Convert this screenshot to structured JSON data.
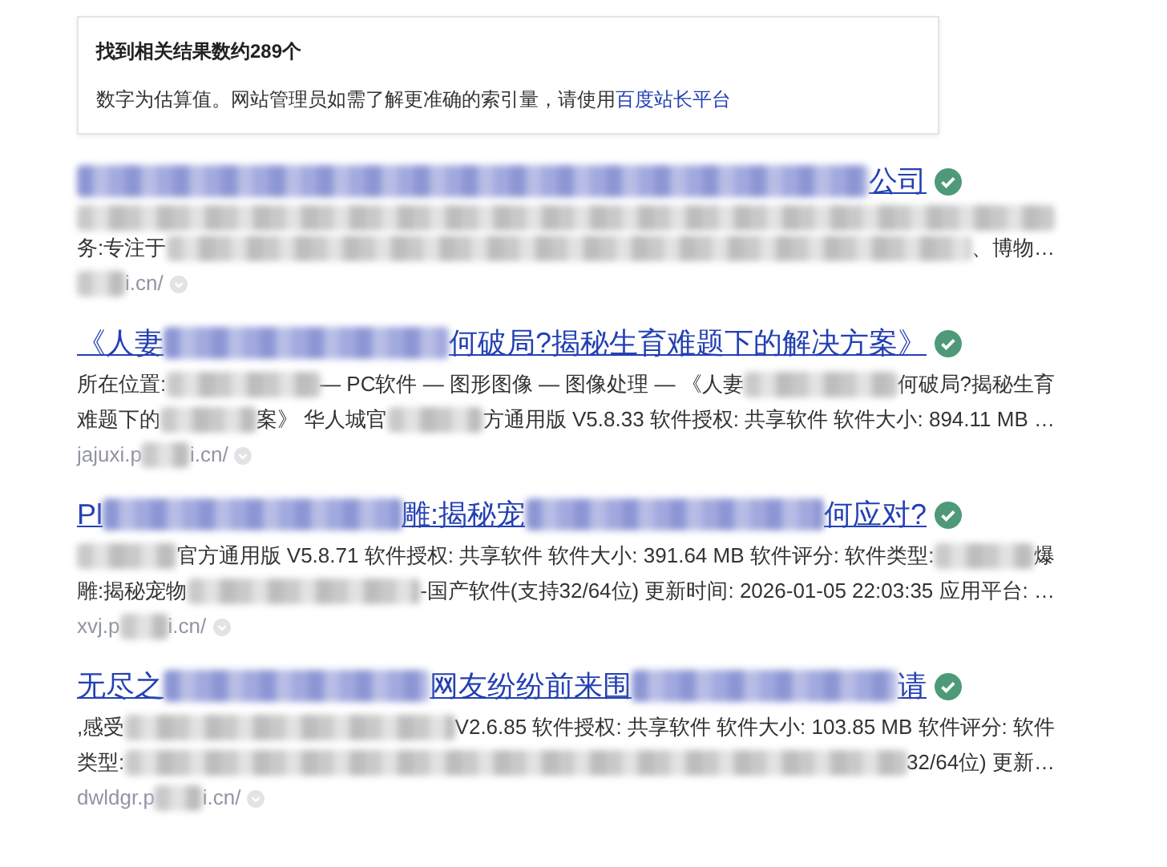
{
  "notice": {
    "heading": "找到相关结果数约289个",
    "text": "数字为估算值。网站管理员如需了解更准确的索引量，请使用",
    "link": "百度站长平台"
  },
  "results": [
    {
      "title": [
        {
          "kind": "blur"
        },
        {
          "kind": "text",
          "text": "公司"
        }
      ],
      "verified": true,
      "abstract": [
        [
          {
            "kind": "blur"
          }
        ],
        [
          {
            "kind": "text",
            "text": "务:专注于"
          },
          {
            "kind": "blur"
          },
          {
            "kind": "text",
            "text": "、博物…"
          }
        ]
      ],
      "url": [
        {
          "kind": "blur"
        },
        {
          "kind": "text",
          "text": "i.cn/"
        }
      ]
    },
    {
      "title": [
        {
          "kind": "text",
          "text": "《人妻"
        },
        {
          "kind": "blur"
        },
        {
          "kind": "text",
          "text": "何破局?揭秘生育难题下的解决方案》"
        }
      ],
      "verified": true,
      "abstract": [
        [
          {
            "kind": "text",
            "text": "所在位置:"
          },
          {
            "kind": "blur"
          },
          {
            "kind": "text",
            "text": " — PC软件 — 图形图像 — 图像处理 — 《人妻"
          },
          {
            "kind": "blur"
          },
          {
            "kind": "text",
            "text": "何破局?揭秘生育"
          }
        ],
        [
          {
            "kind": "text",
            "text": "难题下的"
          },
          {
            "kind": "blur"
          },
          {
            "kind": "text",
            "text": "案》 华人城官"
          },
          {
            "kind": "blur"
          },
          {
            "kind": "text",
            "text": "方通用版 V5.8.33 软件授权: 共享软件 软件大小: 894.11 MB …"
          }
        ]
      ],
      "url": [
        {
          "kind": "text",
          "text": "jajuxi.p"
        },
        {
          "kind": "blur"
        },
        {
          "kind": "text",
          "text": "i.cn/"
        }
      ]
    },
    {
      "title": [
        {
          "kind": "text",
          "text": "Pl"
        },
        {
          "kind": "blur"
        },
        {
          "kind": "text",
          "text": "雕:揭秘宠"
        },
        {
          "kind": "blur"
        },
        {
          "kind": "text",
          "text": "何应对?"
        }
      ],
      "verified": true,
      "abstract": [
        [
          {
            "kind": "blur"
          },
          {
            "kind": "text",
            "text": "官方通用版 V5.8.71 软件授权: 共享软件 软件大小: 391.64 MB 软件评分: 软件类型:"
          },
          {
            "kind": "blur"
          },
          {
            "kind": "text",
            "text": "爆"
          }
        ],
        [
          {
            "kind": "text",
            "text": "雕:揭秘宠物"
          },
          {
            "kind": "blur"
          },
          {
            "kind": "text",
            "text": "-国产软件(支持32/64位) 更新时间: 2026-01-05 22:03:35 应用平台: …"
          }
        ]
      ],
      "url": [
        {
          "kind": "text",
          "text": "xvj.p"
        },
        {
          "kind": "blur"
        },
        {
          "kind": "text",
          "text": "i.cn/"
        }
      ]
    },
    {
      "title": [
        {
          "kind": "text",
          "text": "无尽之"
        },
        {
          "kind": "blur"
        },
        {
          "kind": "text",
          "text": "网友纷纷前来围"
        },
        {
          "kind": "blur"
        },
        {
          "kind": "text",
          "text": "请"
        }
      ],
      "verified": true,
      "abstract": [
        [
          {
            "kind": "text",
            "text": ",感受"
          },
          {
            "kind": "blur"
          },
          {
            "kind": "text",
            "text": "V2.6.85 软件授权: 共享软件 软件大小: 103.85 MB 软件评分: 软件"
          }
        ],
        [
          {
            "kind": "text",
            "text": "类型:"
          },
          {
            "kind": "blur"
          },
          {
            "kind": "text",
            "text": "32/64位) 更新…"
          }
        ]
      ],
      "url": [
        {
          "kind": "text",
          "text": "dwldgr.p"
        },
        {
          "kind": "blur"
        },
        {
          "kind": "text",
          "text": "i.cn/"
        }
      ]
    }
  ]
}
